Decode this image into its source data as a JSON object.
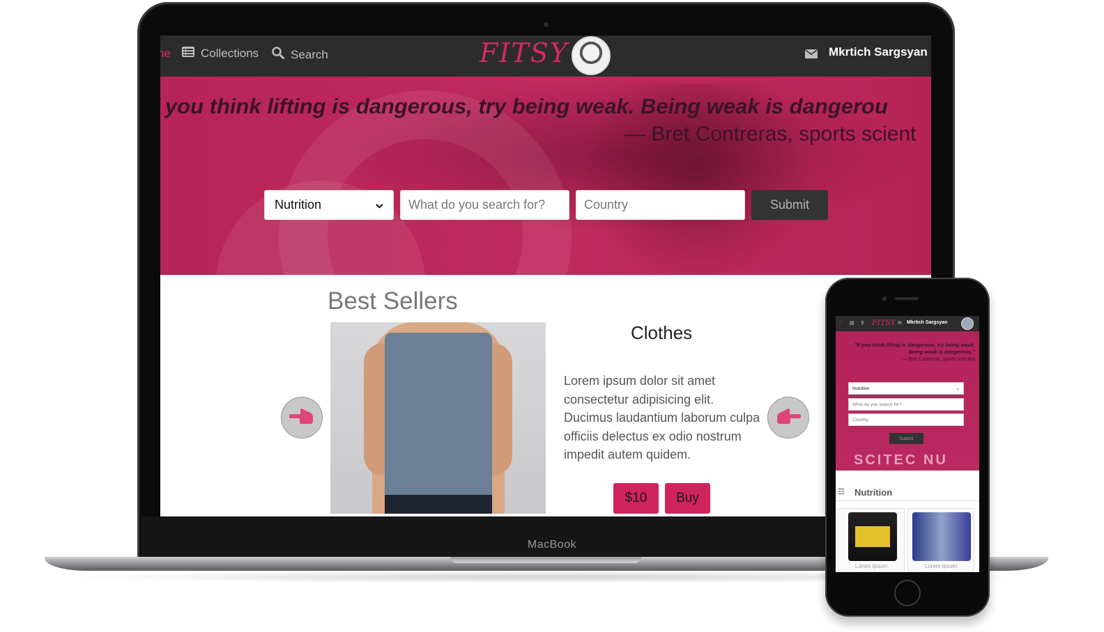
{
  "site": {
    "brand": "FITSY",
    "nav": {
      "home_partial": "ne",
      "collections": "Collections",
      "search": "Search",
      "user": "Mkrtich Sargsyan"
    },
    "hero": {
      "quote": "f you think lifting is dangerous, try being weak. Being weak is dangerou",
      "author": "— Bret Contreras, sports scient",
      "category_selected": "Nutrition",
      "search_placeholder": "What do you search for?",
      "country_placeholder": "Country",
      "submit": "Submit"
    },
    "best_sellers": {
      "title": "Best Sellers",
      "product_name": "Clothes",
      "description": "Lorem ipsum dolor sit amet consectetur adipisicing elit. Ducimus laudantium laborum culpa officiis delectus ex odio nostrum impedit autem quidem.",
      "price": "$10",
      "buy": "Buy"
    }
  },
  "device_label": "MacBook",
  "phone": {
    "brand": "FITSY",
    "user": "Mkrtich Sargsyan",
    "quote": "\"If you think lifting is dangerous, try being weak. Being weak is dangerous.\"",
    "author": "— Bret Contreras, sports scientist",
    "category_selected": "Nutrition",
    "search_placeholder": "What do you search for?",
    "country_placeholder": "Country",
    "submit": "Submit",
    "banner": "SCITEC NU",
    "section": "Nutrition",
    "card_caption_1": "Lorem ipsum",
    "card_caption_2": "Lorem ipsum"
  },
  "colors": {
    "accent": "#d42a64",
    "hero": "#c02a5e",
    "nav": "#2c2c2c"
  }
}
